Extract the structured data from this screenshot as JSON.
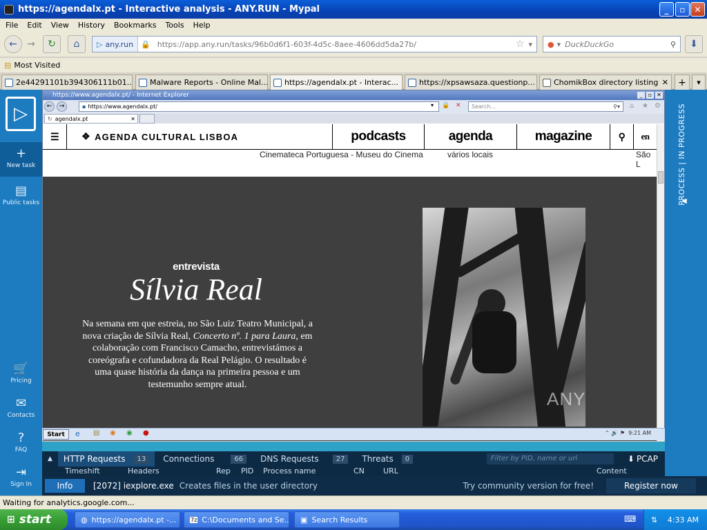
{
  "window": {
    "title": "https://agendalx.pt - Interactive analysis - ANY.RUN - Mypal"
  },
  "menu": [
    "File",
    "Edit",
    "View",
    "History",
    "Bookmarks",
    "Tools",
    "Help"
  ],
  "nav": {
    "site_label": "any.run",
    "url": "https://app.any.run/tasks/96b0d6f1-603f-4d5c-8aee-4606dd5da27b/",
    "search_placeholder": "DuckDuckGo"
  },
  "bookmarks": {
    "most_visited": "Most Visited"
  },
  "tabs": [
    {
      "label": "2e44291101b394306111b01..."
    },
    {
      "label": "Malware Reports - Online Mal..."
    },
    {
      "label": "https://agendalx.pt - Interac..."
    },
    {
      "label": "https://xpsawsaza.questionp..."
    },
    {
      "label": "ChomikBox directory listing"
    }
  ],
  "sidebar": {
    "new_task": "New task",
    "public_tasks": "Public tasks",
    "pricing": "Pricing",
    "contacts": "Contacts",
    "faq": "FAQ",
    "sign_in": "Sign In"
  },
  "rightbar": {
    "status": "PROCESS | IN PROGRESS"
  },
  "ie": {
    "title": "https://www.agendalx.pt/ - Internet Explorer",
    "address": "https://www.agendalx.pt/",
    "search_placeholder": "Search...",
    "tab": "agendalx.pt"
  },
  "site": {
    "logo": "AGENDA CULTURAL LISBOA",
    "nav": [
      "podcasts",
      "agenda",
      "magazine"
    ],
    "lang": "en",
    "sub1": "Cinemateca Portuguesa - Museu do Cinema",
    "sub2": "vários locais",
    "sub3": "São L",
    "kicker": "entrevista",
    "headline": "Sílvia Real",
    "body_1": "Na semana em que estreia, no São Luiz Teatro Municipal, a nova criação de Sílvia Real, ",
    "body_em": "Concerto nº. 1 para Laura",
    "body_2": ", em colaboração com Francisco Camacho, entrevistámos a coreógrafa e cofundadora da Real Pelágio. O resultado é uma quase história da dança na primeira pessoa e um testemunho sempre atual.",
    "watermark": "ANY RUN"
  },
  "ie_taskbar": {
    "start": "Start",
    "time": "9:21 AM"
  },
  "network": {
    "tabs": [
      {
        "label": "HTTP Requests",
        "count": "13"
      },
      {
        "label": "Connections",
        "count": "66"
      },
      {
        "label": "DNS Requests",
        "count": "27"
      },
      {
        "label": "Threats",
        "count": "0"
      }
    ],
    "filter_placeholder": "Filter by PID, name or url",
    "pcap": "PCAP",
    "columns": [
      "Timeshift",
      "Headers",
      "Rep",
      "PID",
      "Process name",
      "CN",
      "URL",
      "Content"
    ]
  },
  "info": {
    "label": "Info",
    "pid_process": "[2072] iexplore.exe",
    "message": "Creates files in the user directory",
    "promo": "Try community version for free!",
    "register": "Register now"
  },
  "status": {
    "text": "Waiting for analytics.google.com..."
  },
  "taskbar": {
    "start": "start",
    "items": [
      "https://agendalx.pt -...",
      "C:\\Documents and Se...",
      "Search Results"
    ],
    "time": "4:33 AM"
  }
}
